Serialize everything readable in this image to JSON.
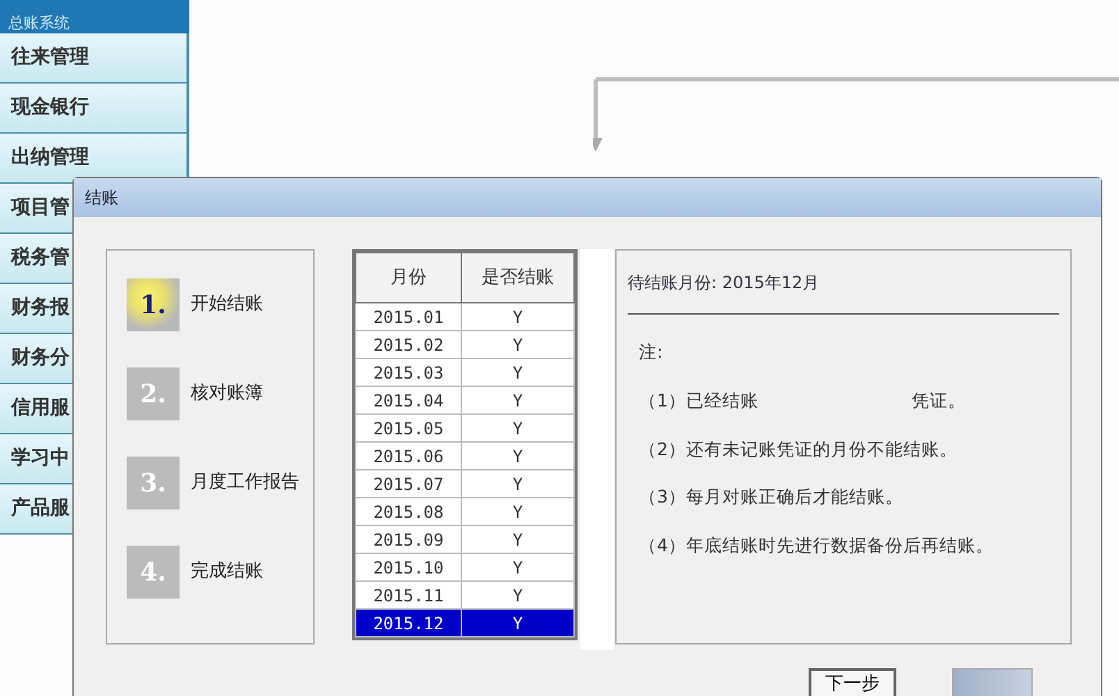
{
  "sidebar": {
    "title": "总账系统",
    "items": [
      {
        "label": "往来管理"
      },
      {
        "label": "现金银行"
      },
      {
        "label": "出纳管理"
      },
      {
        "label": "项目管"
      },
      {
        "label": "税务管"
      },
      {
        "label": "财务报"
      },
      {
        "label": "财务分"
      },
      {
        "label": "信用服"
      },
      {
        "label": "学习中"
      },
      {
        "label": "产品服"
      }
    ]
  },
  "dialog": {
    "title": "结账",
    "steps": [
      {
        "number": "1.",
        "label": "开始结账",
        "selected": true
      },
      {
        "number": "2.",
        "label": "核对账簿",
        "selected": false
      },
      {
        "number": "3.",
        "label": "月度工作报告",
        "selected": false
      },
      {
        "number": "4.",
        "label": "完成结账",
        "selected": false
      }
    ],
    "table": {
      "columns": [
        "月份",
        "是否结账"
      ],
      "rows": [
        {
          "cells": [
            "2015.01",
            "Y"
          ],
          "selected": false
        },
        {
          "cells": [
            "2015.02",
            "Y"
          ],
          "selected": false
        },
        {
          "cells": [
            "2015.03",
            "Y"
          ],
          "selected": false
        },
        {
          "cells": [
            "2015.04",
            "Y"
          ],
          "selected": false
        },
        {
          "cells": [
            "2015.05",
            "Y"
          ],
          "selected": false
        },
        {
          "cells": [
            "2015.06",
            "Y"
          ],
          "selected": false
        },
        {
          "cells": [
            "2015.07",
            "Y"
          ],
          "selected": false
        },
        {
          "cells": [
            "2015.08",
            "Y"
          ],
          "selected": false
        },
        {
          "cells": [
            "2015.09",
            "Y"
          ],
          "selected": false
        },
        {
          "cells": [
            "2015.10",
            "Y"
          ],
          "selected": false
        },
        {
          "cells": [
            "2015.11",
            "Y"
          ],
          "selected": false
        },
        {
          "cells": [
            "2015.12",
            "Y"
          ],
          "selected": true
        }
      ]
    },
    "pending": "待结账月份: 2015年12月",
    "note_title": "注:",
    "notes": [
      [
        "（1）已经结账",
        "凭证。"
      ],
      [
        "（2）还有未记账凭证的月份不能结账。"
      ],
      [
        "（3）每月对账正确后才能结账。"
      ],
      [
        "（4）年底结账时先进行数据备份后再结账。"
      ]
    ],
    "buttons": [
      "下一步"
    ]
  }
}
